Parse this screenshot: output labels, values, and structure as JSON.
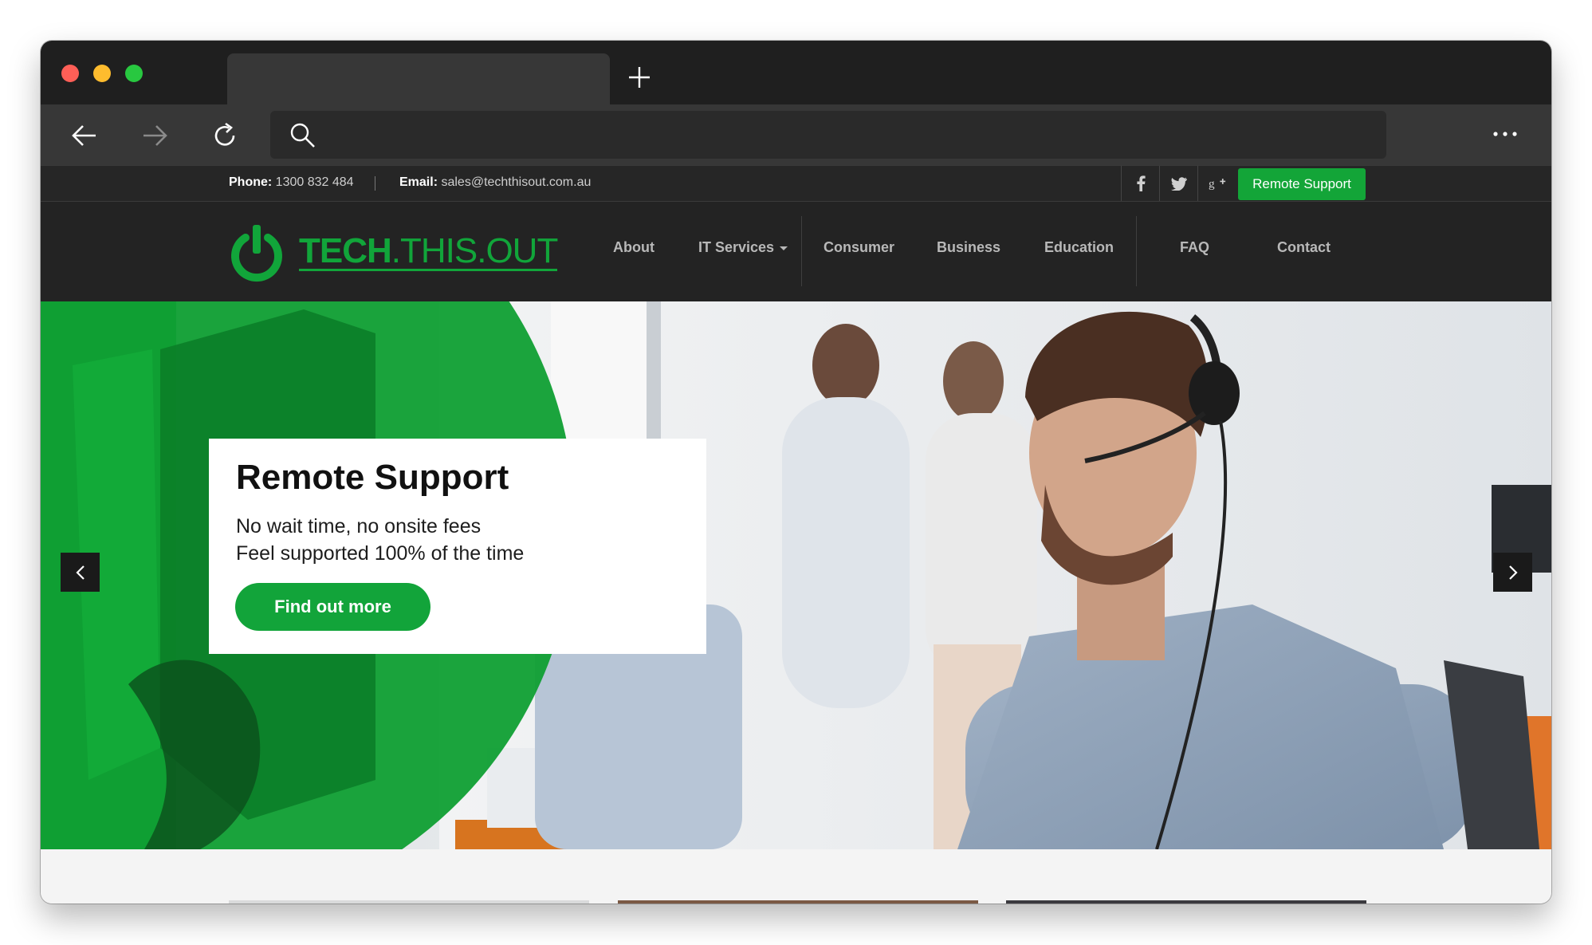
{
  "browser": {
    "new_tab_icon": "plus-icon",
    "back_icon": "arrow-left-icon",
    "forward_icon": "arrow-right-icon",
    "reload_icon": "reload-icon",
    "search_icon": "search-icon",
    "menu_icon": "more-dots-icon"
  },
  "topbar": {
    "phone_label": "Phone:",
    "phone_value": "1300 832 484",
    "email_label": "Email:",
    "email_value": "sales@techthisout.com.au",
    "social": [
      "facebook-icon",
      "twitter-icon",
      "google-plus-icon"
    ],
    "remote_support_button": "Remote Support"
  },
  "header": {
    "logo_bold": "TECH",
    "logo_rest": ".THIS.OUT",
    "nav": {
      "about": "About",
      "it_services": "IT Services",
      "consumer": "Consumer",
      "business": "Business",
      "education": "Education",
      "faq": "FAQ",
      "contact": "Contact"
    }
  },
  "hero": {
    "title": "Remote Support",
    "line1": "No wait time, no onsite fees",
    "line2": "Feel supported 100% of the time",
    "button": "Find out more",
    "prev_icon": "chevron-left-icon",
    "next_icon": "chevron-right-icon"
  },
  "colors": {
    "brand_green": "#13a538",
    "topbar_bg": "#262626",
    "header_bg": "#232323"
  }
}
